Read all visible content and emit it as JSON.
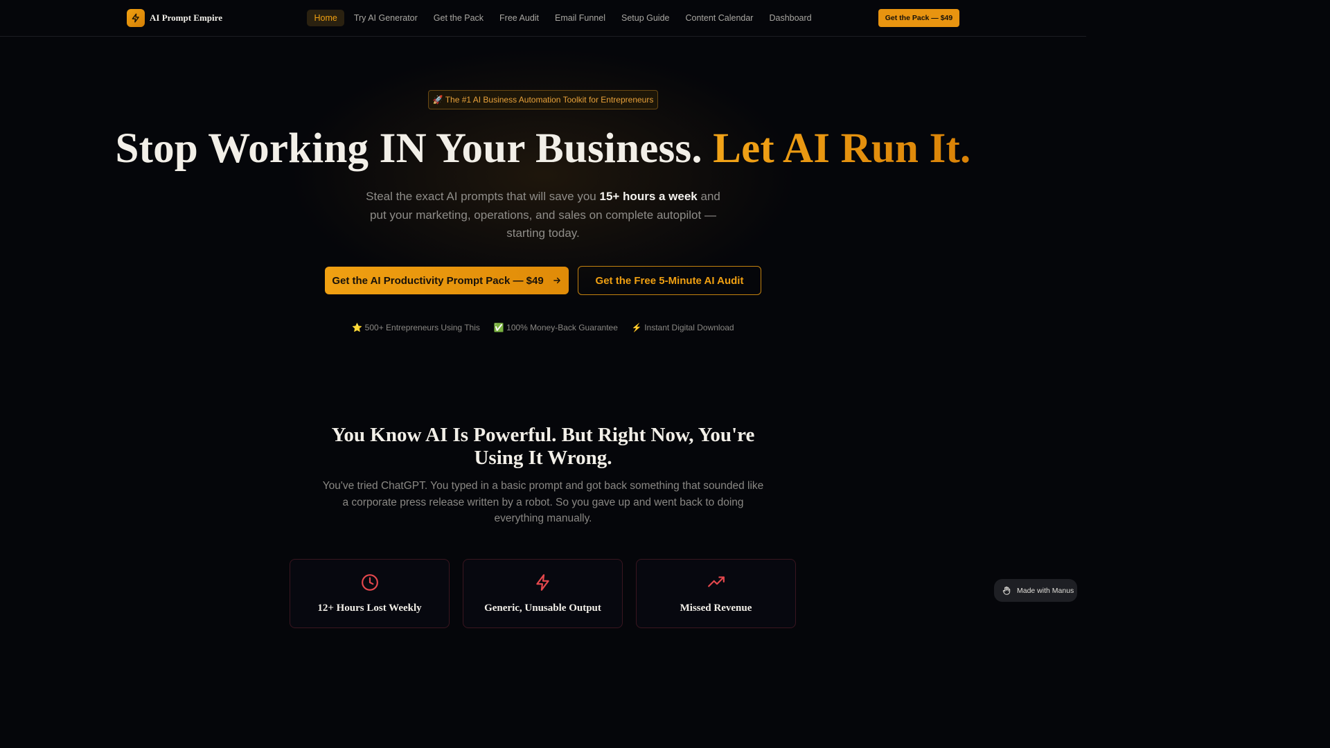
{
  "nav": {
    "brand": "AI Prompt Empire",
    "links": [
      "Home",
      "Try AI Generator",
      "Get the Pack",
      "Free Audit",
      "Email Funnel",
      "Setup Guide",
      "Content Calendar",
      "Dashboard"
    ],
    "active_link": "Home",
    "cta": "Get the Pack — $49"
  },
  "hero": {
    "badge": "🚀 The #1 AI Business Automation Toolkit for Entrepreneurs",
    "title_main": "Stop Working IN Your Business. ",
    "title_accent": "Let AI Run It.",
    "sub_before": "Steal the exact AI prompts that will save you ",
    "sub_bold": "15+ hours a week",
    "sub_after": " and put your marketing, operations, and sales on complete autopilot — starting today.",
    "primary_button": "Get the AI Productivity Prompt Pack — $49",
    "secondary_button": "Get the Free 5-Minute AI Audit",
    "trust": [
      "⭐ 500+ Entrepreneurs Using This",
      "✅ 100% Money-Back Guarantee",
      "⚡ Instant Digital Download"
    ]
  },
  "problem": {
    "title": "You Know AI Is Powerful. But Right Now, You're Using It Wrong.",
    "text": "You've tried ChatGPT. You typed in a basic prompt and got back something that sounded like a corporate press release written by a robot. So you gave up and went back to doing everything manually.",
    "cards": [
      {
        "title": "12+ Hours Lost Weekly",
        "icon": "clock-icon"
      },
      {
        "title": "Generic, Unusable Output",
        "icon": "lightning-icon"
      },
      {
        "title": "Missed Revenue",
        "icon": "trending-up-icon"
      }
    ]
  },
  "footer_badge": "Made with Manus",
  "colors": {
    "accent": "#f0a012",
    "background": "#05060a",
    "danger": "#e5484d"
  }
}
